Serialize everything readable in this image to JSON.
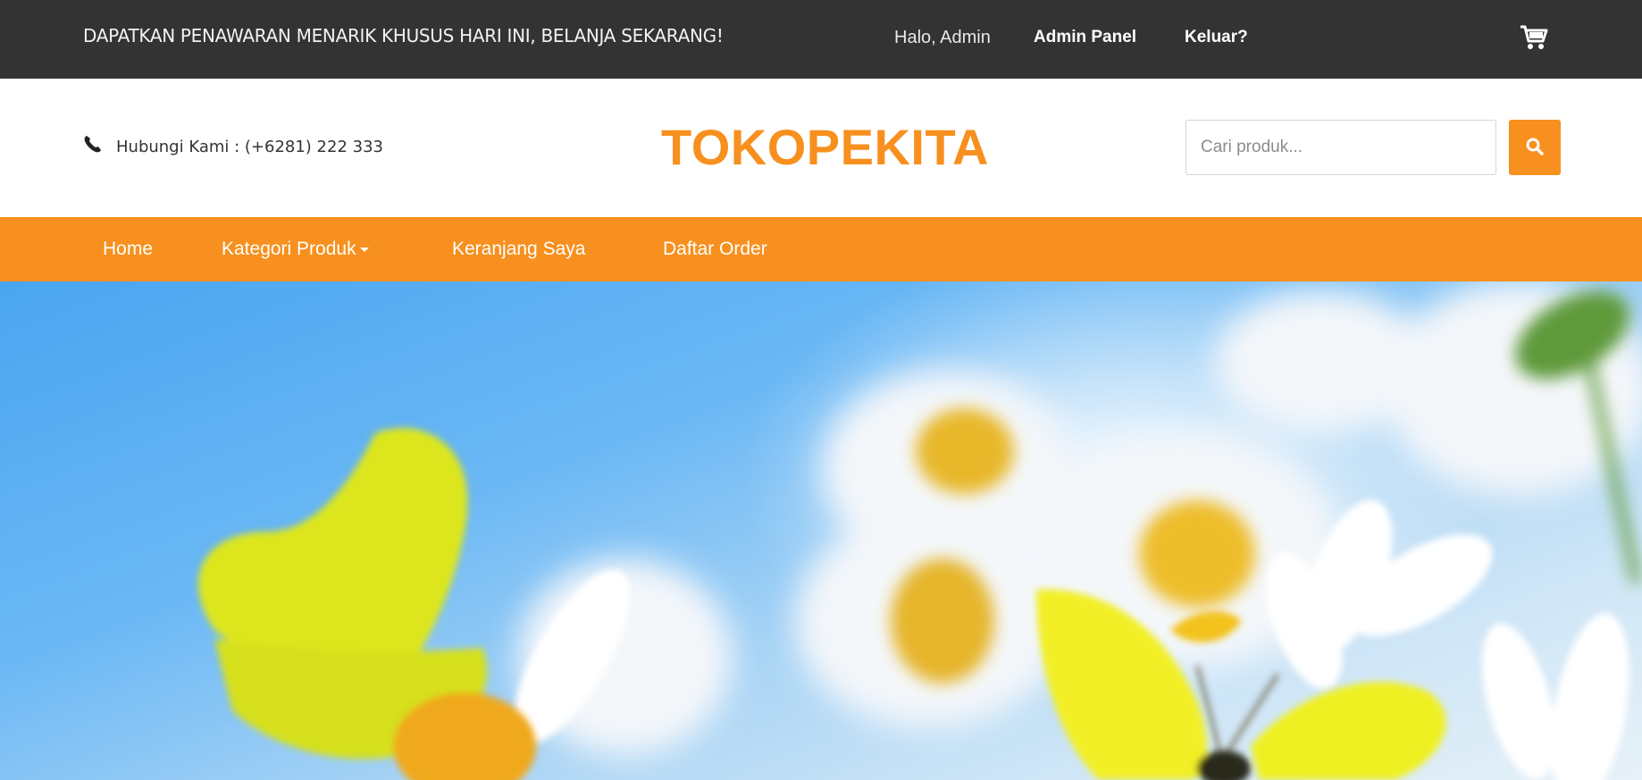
{
  "topbar": {
    "promo_text": "DAPATKAN PENAWARAN MENARIK KHUSUS HARI INI, BELANJA SEKARANG!",
    "greeting": "Halo, Admin",
    "admin_panel_label": "Admin Panel",
    "logout_label": "Keluar?",
    "cart_icon": "cart-icon"
  },
  "header": {
    "contact_text": "Hubungi Kami : (+6281) 222 333",
    "phone_icon": "phone-icon",
    "logo_text": "TOKOPEKITA",
    "search": {
      "placeholder": "Cari produk...",
      "value": "",
      "button_icon": "search-icon"
    }
  },
  "nav": {
    "items": [
      {
        "label": "Home"
      },
      {
        "label": "Kategori Produk"
      },
      {
        "label": "Keranjang Saya"
      },
      {
        "label": "Daftar Order"
      }
    ]
  },
  "colors": {
    "topbar_bg": "#333333",
    "accent": "#f7901e",
    "sky": "#4aa5f0"
  }
}
